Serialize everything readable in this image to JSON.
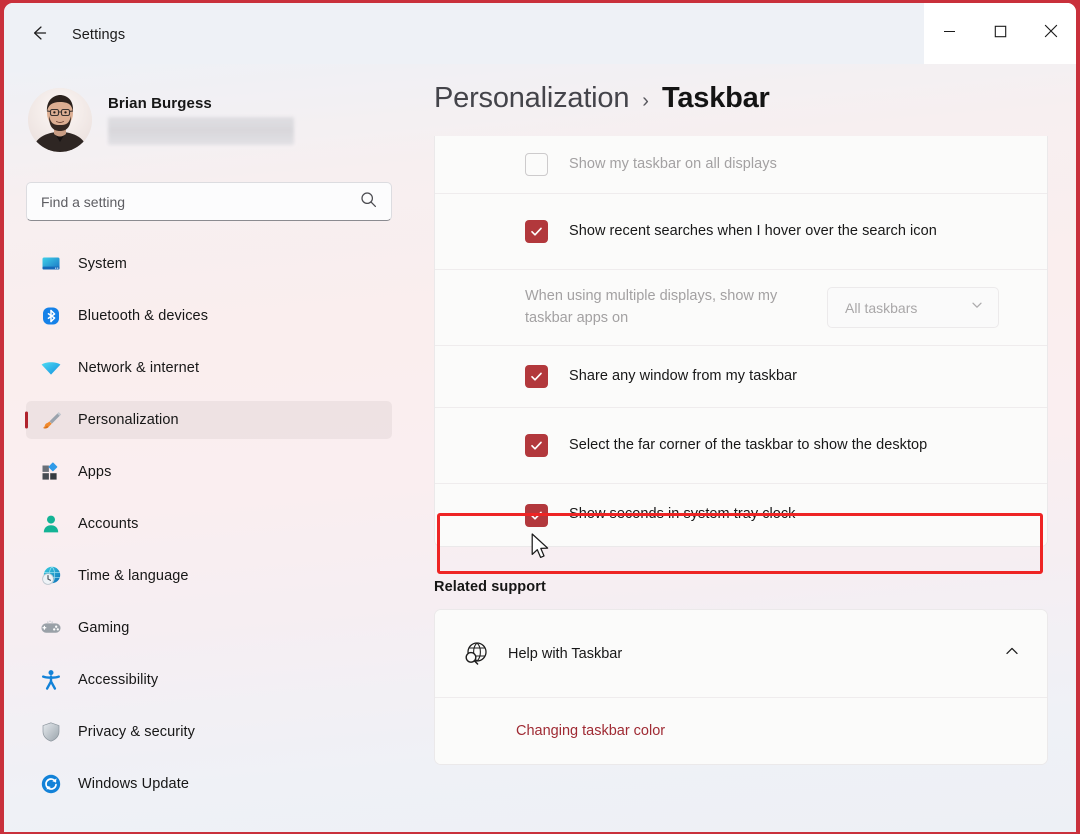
{
  "window": {
    "app_title": "Settings",
    "back_icon": "arrow-left-icon",
    "controls": {
      "minimize": "minimize-icon",
      "maximize": "maximize-icon",
      "close": "close-icon"
    }
  },
  "sidebar": {
    "account": {
      "name": "Brian Burgess",
      "email_redacted": true,
      "avatar_icon": "user-avatar-photo"
    },
    "search": {
      "placeholder": "Find a setting",
      "value": "",
      "icon": "search-icon"
    },
    "items": [
      {
        "label": "System",
        "icon": "monitor-icon",
        "selected": false
      },
      {
        "label": "Bluetooth & devices",
        "icon": "bluetooth-icon",
        "selected": false
      },
      {
        "label": "Network & internet",
        "icon": "wifi-icon",
        "selected": false
      },
      {
        "label": "Personalization",
        "icon": "paintbrush-icon",
        "selected": true
      },
      {
        "label": "Apps",
        "icon": "apps-blocks-icon",
        "selected": false
      },
      {
        "label": "Accounts",
        "icon": "person-icon",
        "selected": false
      },
      {
        "label": "Time & language",
        "icon": "clock-globe-icon",
        "selected": false
      },
      {
        "label": "Gaming",
        "icon": "gamepad-icon",
        "selected": false
      },
      {
        "label": "Accessibility",
        "icon": "accessibility-icon",
        "selected": false
      },
      {
        "label": "Privacy & security",
        "icon": "shield-icon",
        "selected": false
      },
      {
        "label": "Windows Update",
        "icon": "update-refresh-icon",
        "selected": false
      }
    ]
  },
  "content": {
    "breadcrumb": {
      "parent": "Personalization",
      "separator": "›",
      "current": "Taskbar"
    },
    "settings_rows": [
      {
        "type": "checkbox",
        "label": "Show my taskbar on all displays",
        "checked": false,
        "disabled": true,
        "highlighted": false
      },
      {
        "type": "checkbox",
        "label": "Show recent searches when I hover over the search icon",
        "checked": true,
        "disabled": false,
        "highlighted": false
      },
      {
        "type": "dropdown",
        "label": "When using multiple displays, show my taskbar apps on",
        "value": "All taskbars",
        "chevron": "chevron-down-icon",
        "disabled": true,
        "highlighted": false
      },
      {
        "type": "checkbox",
        "label": "Share any window from my taskbar",
        "checked": true,
        "disabled": false,
        "highlighted": false
      },
      {
        "type": "checkbox",
        "label": "Select the far corner of the taskbar to show the desktop",
        "checked": true,
        "disabled": false,
        "highlighted": false
      },
      {
        "type": "checkbox",
        "label": "Show seconds in system tray clock",
        "checked": true,
        "disabled": false,
        "highlighted": true
      }
    ],
    "related_support": {
      "section_title": "Related support",
      "help_row": {
        "label": "Help with Taskbar",
        "icon": "globe-search-icon",
        "expand_icon": "chevron-up-icon"
      },
      "links": [
        {
          "label": "Changing taskbar color"
        }
      ]
    }
  },
  "colors": {
    "accent_checkbox": "#b2383c",
    "accent_link": "#9f2a33",
    "selection_bar": "#b0222c",
    "annotation_red": "#ee2424",
    "frame_red": "#c9303b"
  },
  "annotation": {
    "target_row_label": "Show seconds in system tray clock",
    "shape": "rectangle"
  },
  "cursor": {
    "icon": "arrow-cursor"
  }
}
